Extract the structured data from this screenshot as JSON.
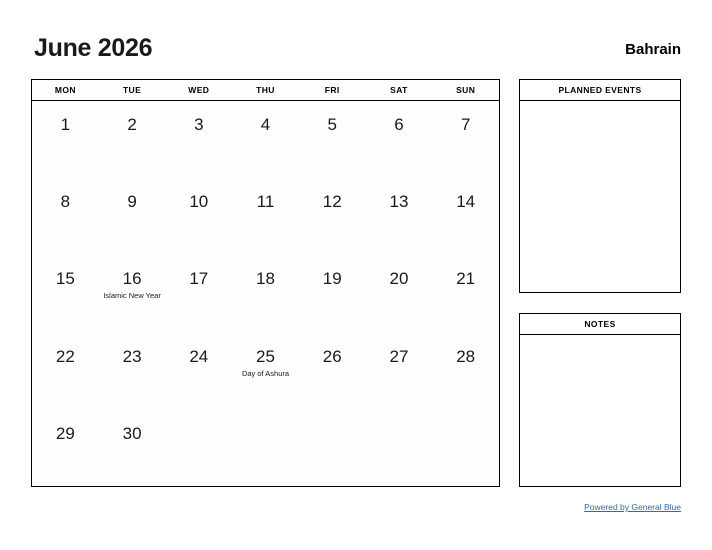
{
  "header": {
    "month_title": "June 2026",
    "country": "Bahrain"
  },
  "calendar": {
    "day_headers": [
      "MON",
      "TUE",
      "WED",
      "THU",
      "FRI",
      "SAT",
      "SUN"
    ],
    "weeks": [
      [
        {
          "day": "1",
          "events": []
        },
        {
          "day": "2",
          "events": []
        },
        {
          "day": "3",
          "events": []
        },
        {
          "day": "4",
          "events": []
        },
        {
          "day": "5",
          "events": []
        },
        {
          "day": "6",
          "events": []
        },
        {
          "day": "7",
          "events": []
        }
      ],
      [
        {
          "day": "8",
          "events": []
        },
        {
          "day": "9",
          "events": []
        },
        {
          "day": "10",
          "events": []
        },
        {
          "day": "11",
          "events": []
        },
        {
          "day": "12",
          "events": []
        },
        {
          "day": "13",
          "events": []
        },
        {
          "day": "14",
          "events": []
        }
      ],
      [
        {
          "day": "15",
          "events": []
        },
        {
          "day": "16",
          "events": [
            "Islamic New Year"
          ]
        },
        {
          "day": "17",
          "events": []
        },
        {
          "day": "18",
          "events": []
        },
        {
          "day": "19",
          "events": []
        },
        {
          "day": "20",
          "events": []
        },
        {
          "day": "21",
          "events": []
        }
      ],
      [
        {
          "day": "22",
          "events": []
        },
        {
          "day": "23",
          "events": []
        },
        {
          "day": "24",
          "events": []
        },
        {
          "day": "25",
          "events": [
            "Day of Ashura"
          ]
        },
        {
          "day": "26",
          "events": []
        },
        {
          "day": "27",
          "events": []
        },
        {
          "day": "28",
          "events": []
        }
      ],
      [
        {
          "day": "29",
          "events": []
        },
        {
          "day": "30",
          "events": []
        },
        {
          "day": "",
          "events": []
        },
        {
          "day": "",
          "events": []
        },
        {
          "day": "",
          "events": []
        },
        {
          "day": "",
          "events": []
        },
        {
          "day": "",
          "events": []
        }
      ]
    ]
  },
  "panels": {
    "planned_events": {
      "title": "PLANNED EVENTS",
      "lines": []
    },
    "notes": {
      "title": "NOTES",
      "lines": []
    }
  },
  "footer": {
    "link_text": "Powered by General Blue",
    "link_color": "#2b6cb5"
  }
}
